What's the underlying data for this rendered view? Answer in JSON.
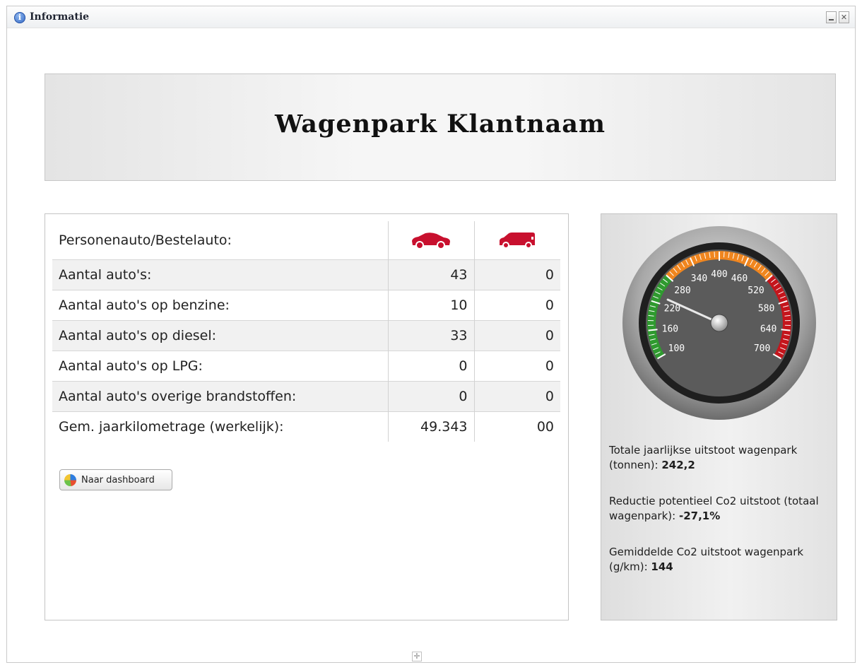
{
  "window": {
    "title": "Informatie"
  },
  "header": {
    "title": "Wagenpark Klantnaam"
  },
  "vehicle_table": {
    "header_label": "Personenauto/Bestelauto:",
    "column_icons": [
      "passenger-car-icon",
      "delivery-van-icon"
    ],
    "rows": [
      {
        "label": "Aantal auto's:",
        "car": "43",
        "van": "0"
      },
      {
        "label": "Aantal auto's op benzine:",
        "car": "10",
        "van": "0"
      },
      {
        "label": "Aantal auto's op diesel:",
        "car": "33",
        "van": "0"
      },
      {
        "label": "Aantal auto's op LPG:",
        "car": "0",
        "van": "0"
      },
      {
        "label": "Aantal auto's overige brandstoffen:",
        "car": "0",
        "van": "0"
      },
      {
        "label": "Gem. jaarkilometrage (werkelijk):",
        "car": "49.343",
        "van": "00"
      }
    ]
  },
  "dashboard_button": {
    "label": "Naar dashboard",
    "icon": "pie-chart-icon"
  },
  "gauge": {
    "tick_labels": [
      "100",
      "160",
      "220",
      "280",
      "340",
      "400",
      "460",
      "520",
      "580",
      "640",
      "700"
    ],
    "needle_value": 236,
    "colors": {
      "low": "#2f9a2f",
      "mid": "#f0861f",
      "high": "#c4151c"
    }
  },
  "stats": {
    "emission_total": {
      "text": "Totale jaarlijkse uitstoot wagenpark (tonnen): ",
      "value": "242,2"
    },
    "reduction": {
      "text": "Reductie potentieel Co2 uitstoot (totaal wagenpark): ",
      "value": "-27,1%"
    },
    "avg_co2": {
      "text": "Gemiddelde Co2 uitstoot wagenpark (g/km): ",
      "value": "144"
    }
  },
  "colors": {
    "vehicle_icon": "#c8102e"
  }
}
